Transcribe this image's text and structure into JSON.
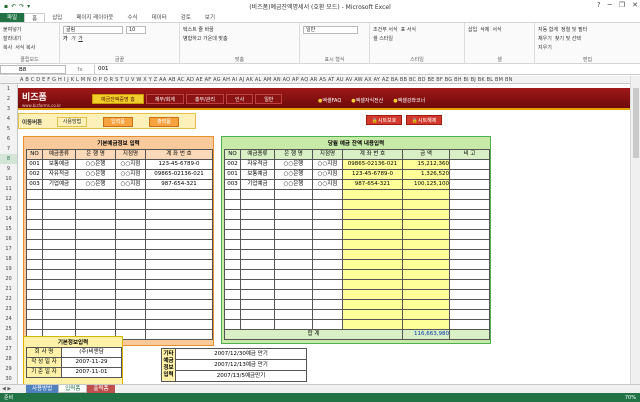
{
  "window": {
    "title": "(비즈폼)예금잔액명세서 (호환 모드) - Microsoft Excel",
    "qa": [
      "▪",
      "↶",
      "↷",
      "▾"
    ],
    "controls": [
      "?",
      "─",
      "❐",
      "✕"
    ]
  },
  "ribbon_tabs": [
    "파일",
    "홈",
    "삽입",
    "페이지 레이아웃",
    "수식",
    "데이터",
    "검토",
    "보기"
  ],
  "ribbon": {
    "clipboard": {
      "paste": "붙여넣기",
      "cut": "잘라내기",
      "copy": "복사",
      "format_painter": "서식 복사",
      "label": "클립보드"
    },
    "font": {
      "name": "굴림",
      "size": "10",
      "label": "글꼴"
    },
    "align": {
      "wrap": "텍스트 줄 바꿈",
      "merge": "병합하고 가운데 맞춤",
      "label": "맞춤"
    },
    "number": {
      "format": "일반",
      "label": "표시 형식"
    },
    "styles": {
      "cond": "조건부 서식",
      "table": "표 서식",
      "cell": "셀 스타일",
      "label": "스타일"
    },
    "cells": {
      "insert": "삽입",
      "delete": "삭제",
      "format": "서식",
      "label": "셀"
    },
    "editing": {
      "autosum": "자동 합계",
      "fill": "채우기",
      "clear": "지우기",
      "sort": "정렬 및 필터",
      "find": "찾기 및 선택",
      "label": "편집"
    }
  },
  "formula_bar": {
    "name_box": "B8",
    "fx": "fx",
    "value": "001"
  },
  "columns": "A B C D E F G H I J K L M N O P Q R S T U V W X Y Z AA AB AC AD AE AF AG AH AI AJ AK AL AM AN AO AP AQ AR AS AT AU AV AW AX AY AZ BA BB BC BD BE BF BG BH BI BJ BK BL BM BN",
  "rows": [
    "1",
    "2",
    "3",
    "4",
    "5",
    "6",
    "7",
    "8",
    "9",
    "10",
    "11",
    "12",
    "13",
    "14",
    "15",
    "16",
    "17",
    "18",
    "19",
    "20",
    "21",
    "22",
    "23",
    "24",
    "25",
    "26",
    "27",
    "28",
    "29",
    "30"
  ],
  "banner": {
    "logo": "비즈폼",
    "logo_sub": "www.bizforms.co.kr",
    "nav": [
      "예금잔액증명 홈",
      "재무/회계",
      "총무/관리",
      "인사",
      "일반"
    ],
    "links": [
      "엑셀FAQ",
      "엑셀자식전산",
      "엑셀강좌코너"
    ]
  },
  "move_bar": {
    "label": "이동버튼",
    "buttons": [
      "사용방법",
      "입력폼",
      "출력폼"
    ]
  },
  "sheet_buttons": {
    "protect": "시트보호",
    "unprotect": "시트해제"
  },
  "basic_info_table": {
    "title": "기본예금정보 입력",
    "headers": [
      "NO",
      "예금종류",
      "은 행 명",
      "지점명",
      "계 좌 번 호"
    ],
    "rows": [
      [
        "001",
        "보통예금",
        "○○은행",
        "○○지점",
        "123-45-6789-0"
      ],
      [
        "002",
        "자유적금",
        "○○은행",
        "○○지점",
        "09865-02136-021"
      ],
      [
        "003",
        "기업예금",
        "○○은행",
        "○○지점",
        "987-654-321"
      ]
    ],
    "empty_rows": 15
  },
  "balance_table": {
    "title": "당월 예금 잔액 내용입력",
    "headers": [
      "NO",
      "예금종류",
      "은 행 명",
      "지점명",
      "계 좌 번 호",
      "금 액",
      "비 고"
    ],
    "rows": [
      [
        "002",
        "자유적금",
        "○○은행",
        "○○지점",
        "09865-02136-021",
        "15,212,360",
        ""
      ],
      [
        "001",
        "보통예금",
        "○○은행",
        "○○지점",
        "123-45-6789-0",
        "1,326,520",
        ""
      ],
      [
        "003",
        "기업예금",
        "○○은행",
        "○○지점",
        "987-654-321",
        "100,125,100",
        ""
      ]
    ],
    "empty_rows": 14,
    "total_label": "합 계",
    "total_value": "116,663,980"
  },
  "company_info": {
    "title": "기본정보입력",
    "rows": [
      [
        "회 사 명",
        "(주)비앤담"
      ],
      [
        "작 성 일 자",
        "2007-11-29"
      ],
      [
        "기 준 일 자",
        "2007-11-01"
      ]
    ]
  },
  "other_info": {
    "label": "기타예금정보입력",
    "rows": [
      "2007/12/30예금 만기",
      "2007/12/13예금 만기",
      "2007/13/5예금만기"
    ]
  },
  "sheet_tabs": [
    "사용방법",
    "입력폼",
    "출력폼"
  ],
  "status": {
    "ready": "준비",
    "zoom": "70%"
  },
  "colors": {
    "banner": "#a01818",
    "accent": "#f1cf2a",
    "excel_green": "#217346"
  }
}
